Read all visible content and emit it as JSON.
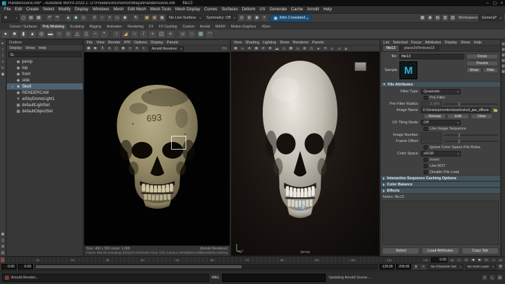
{
  "window": {
    "title": "Randerscene.mb* - Autodesk MAYA 2023.1: D:\\Freelance\\Gnomon\\Maya\\Randerscene.mb",
    "active_node_label": "file13",
    "controls": {
      "minimize": "─",
      "maximize": "▢",
      "close": "×"
    }
  },
  "menu_bar": {
    "items": [
      "File",
      "Edit",
      "Create",
      "Select",
      "Modify",
      "Display",
      "Windows",
      "Mesh",
      "Edit Mesh",
      "Mesh Tools",
      "Mesh Display",
      "Curves",
      "Surfaces",
      "Deform",
      "UV",
      "Generate",
      "Cache",
      "Arnold",
      "Help"
    ]
  },
  "status_line": {
    "menu_set_glyph": "⊞",
    "icons": [
      {
        "name": "new-scene-icon",
        "glyph": "▢"
      },
      {
        "name": "open-scene-icon",
        "glyph": "▤"
      },
      {
        "name": "save-scene-icon",
        "glyph": "▦"
      },
      {
        "name": "separator",
        "glyph": "|",
        "sep": true
      },
      {
        "name": "undo-icon",
        "glyph": "↶"
      },
      {
        "name": "redo-icon",
        "glyph": "↷"
      },
      {
        "name": "separator",
        "glyph": "|",
        "sep": true
      },
      {
        "name": "select-hierarchy-mode-icon",
        "glyph": "▲"
      },
      {
        "name": "select-object-mode-icon",
        "glyph": "◆",
        "color": "#8fd0e8"
      },
      {
        "name": "select-component-mode-icon",
        "glyph": "◇"
      },
      {
        "name": "separator",
        "glyph": "|",
        "sep": true
      },
      {
        "name": "snap-to-grid-icon",
        "glyph": "#"
      },
      {
        "name": "snap-to-curve-icon",
        "glyph": "~"
      },
      {
        "name": "snap-to-point-icon",
        "glyph": "•"
      },
      {
        "name": "snap-to-plane-icon",
        "glyph": "▭"
      },
      {
        "name": "make-live-icon",
        "glyph": "◉"
      },
      {
        "name": "separator",
        "glyph": "|",
        "sep": true
      },
      {
        "name": "construction-history-icon",
        "glyph": "↻"
      },
      {
        "name": "separator",
        "glyph": "|",
        "sep": true
      },
      {
        "name": "render-frame-icon",
        "glyph": "▣",
        "color": "#d9b36c"
      },
      {
        "name": "ipr-render-icon",
        "glyph": "▣",
        "color": "#c98f5a"
      },
      {
        "name": "render-settings-icon",
        "glyph": "▣",
        "color": "#9fb6c9"
      }
    ],
    "live_surface": "No Live Surface",
    "symmetry": "Symmetry: Off",
    "icons2": [
      {
        "name": "soft-selection-icon",
        "glyph": "◎"
      },
      {
        "name": "highlight-backfaces-icon",
        "glyph": "◍"
      },
      {
        "name": "camera-based-selection-icon",
        "glyph": "◉"
      },
      {
        "name": "snap-magnet-icon",
        "glyph": "•"
      }
    ],
    "account": "John Crossland",
    "icons3": [
      {
        "name": "modeling-toolkit-toggle-icon",
        "glyph": "▦"
      },
      {
        "name": "character-controls-toggle-icon",
        "glyph": "◉"
      },
      {
        "name": "channel-box-toggle-icon",
        "glyph": "▤"
      },
      {
        "name": "attribute-editor-toggle-icon",
        "glyph": "▥"
      },
      {
        "name": "tool-settings-toggle-icon",
        "glyph": "▧"
      }
    ],
    "workspace_label": "Workspace:",
    "workspace_value": "General*"
  },
  "shelf": {
    "tabs": [
      {
        "label": "Curves / Surfaces"
      },
      {
        "label": "Poly Modeling",
        "active": true
      },
      {
        "label": "Sculpting"
      },
      {
        "label": "Rigging"
      },
      {
        "label": "Animation"
      },
      {
        "label": "Rendering"
      },
      {
        "label": "FX"
      },
      {
        "label": "FX Caching"
      },
      {
        "label": "Custom"
      },
      {
        "label": "Arnold"
      },
      {
        "label": "MASH"
      },
      {
        "label": "Motion Graphics"
      },
      {
        "label": "XGen"
      }
    ],
    "icons": [
      {
        "name": "poly-sphere-icon",
        "glyph": "●",
        "color": "#b9cfe3"
      },
      {
        "name": "poly-cube-icon",
        "glyph": "■",
        "color": "#b9cfe3"
      },
      {
        "name": "poly-cylinder-icon",
        "glyph": "▮",
        "color": "#b9cfe3"
      },
      {
        "name": "poly-cone-icon",
        "glyph": "▲",
        "color": "#b9cfe3"
      },
      {
        "name": "poly-torus-icon",
        "glyph": "◎",
        "color": "#b9cfe3"
      },
      {
        "name": "poly-plane-icon",
        "glyph": "▬",
        "color": "#b9cfe3"
      },
      {
        "name": "poly-disc-icon",
        "glyph": "○",
        "color": "#b9cfe3"
      },
      {
        "name": "poly-platonic-icon",
        "glyph": "◇",
        "color": "#b9cfe3"
      },
      {
        "name": "poly-pyramid-icon",
        "glyph": "△",
        "color": "#b9cfe3"
      },
      {
        "name": "poly-pipe-icon",
        "glyph": "▯",
        "color": "#b9cfe3"
      },
      {
        "name": "poly-helix-icon",
        "glyph": "~",
        "color": "#b9cfe3"
      },
      {
        "name": "poly-gear-icon",
        "glyph": "*",
        "color": "#b9cfe3"
      },
      {
        "name": "separator",
        "glyph": "|",
        "sep": true
      },
      {
        "name": "extrude-icon",
        "glyph": "↑",
        "color": "#dcb36e"
      },
      {
        "name": "bevel-icon",
        "glyph": "◢",
        "color": "#dcb36e"
      },
      {
        "name": "bridge-icon",
        "glyph": "∩",
        "color": "#dcb36e"
      },
      {
        "name": "multi-cut-icon",
        "glyph": "/",
        "color": "#dcb36e"
      },
      {
        "name": "target-weld-icon",
        "glyph": "+",
        "color": "#dcb36e"
      },
      {
        "name": "mirror-icon",
        "glyph": "◫",
        "color": "#c9c9c9"
      },
      {
        "name": "smooth-icon",
        "glyph": "≈",
        "color": "#c9c9c9"
      },
      {
        "name": "separator",
        "glyph": "|",
        "sep": true
      },
      {
        "name": "boolean-union-icon",
        "glyph": "∪",
        "color": "#a4cb9d"
      },
      {
        "name": "boolean-difference-icon",
        "glyph": "∩",
        "color": "#cb9d9d"
      },
      {
        "name": "quad-draw-icon",
        "glyph": "▦",
        "color": "#9dc4cb"
      },
      {
        "name": "sculpt-brush-icon",
        "glyph": "◠",
        "color": "#cbbf9d"
      }
    ]
  },
  "toolbox": {
    "tools": [
      {
        "name": "select-tool-icon",
        "glyph": "▸"
      },
      {
        "name": "lasso-tool-icon",
        "glyph": "○"
      },
      {
        "name": "paint-select-tool-icon",
        "glyph": "/"
      },
      {
        "name": "move-tool-icon",
        "glyph": "+"
      },
      {
        "name": "rotate-tool-icon",
        "glyph": "↻"
      },
      {
        "name": "scale-tool-icon",
        "glyph": "▣"
      }
    ],
    "layouts": [
      {
        "name": "single-pane-layout-icon",
        "glyph": "▣"
      },
      {
        "name": "two-pane-layout-icon",
        "glyph": "◫"
      },
      {
        "name": "four-pane-layout-icon",
        "glyph": "⊞"
      },
      {
        "name": "outliner-layout-icon",
        "glyph": "▤"
      }
    ]
  },
  "outliner": {
    "title": "Outliner",
    "menus": [
      "Display",
      "Show",
      "Help"
    ],
    "items": [
      {
        "label": "persp",
        "icon": "camera-icon",
        "glyph": "◉",
        "color": "#b9c4cc",
        "arrow": ""
      },
      {
        "label": "top",
        "icon": "camera-icon",
        "glyph": "◉",
        "color": "#b9c4cc",
        "arrow": ""
      },
      {
        "label": "front",
        "icon": "camera-icon",
        "glyph": "◉",
        "color": "#b9c4cc",
        "arrow": ""
      },
      {
        "label": "side",
        "icon": "camera-icon",
        "glyph": "◉",
        "color": "#b9c4cc",
        "arrow": ""
      },
      {
        "label": "Skull",
        "icon": "mesh-icon",
        "glyph": "■",
        "color": "#cdd3d8",
        "arrow": "▸",
        "selected": true
      },
      {
        "label": "RENDERCAM",
        "icon": "camera-icon",
        "glyph": "◉",
        "color": "#b9c4cc",
        "arrow": ""
      },
      {
        "label": "aiSkyDomeLight1",
        "icon": "skydome-light-icon",
        "glyph": "☀",
        "color": "#e6d07b",
        "arrow": ""
      },
      {
        "label": "defaultLightSet",
        "icon": "set-icon",
        "glyph": "▦",
        "color": "#b5b5b5",
        "arrow": ""
      },
      {
        "label": "defaultObjectSet",
        "icon": "set-icon",
        "glyph": "▦",
        "color": "#b5b5b5",
        "arrow": ""
      }
    ]
  },
  "render_view": {
    "menus": [
      "File",
      "View",
      "Render",
      "IPR",
      "Options",
      "Display",
      "Panels"
    ],
    "toolbar_icons": [
      {
        "name": "redraw-render-icon",
        "glyph": "▣"
      },
      {
        "name": "ipr-redraw-icon",
        "glyph": "▶"
      },
      {
        "name": "pause-ipr-icon",
        "glyph": "‖"
      },
      {
        "name": "stop-render-icon",
        "glyph": "■",
        "color": "#d06a5a"
      },
      {
        "name": "region-render-icon",
        "glyph": "▢"
      },
      {
        "name": "snapshot-icon",
        "glyph": "◉"
      },
      {
        "name": "rgb-channels-icon",
        "glyph": "●",
        "color": "#cf6a5a"
      },
      {
        "name": "alpha-channel-icon",
        "glyph": "α"
      },
      {
        "name": "exposure-icon",
        "glyph": "◐"
      }
    ],
    "renderer_label": "Arnold Renderer",
    "progress": "0%",
    "skull_marking": "693",
    "info_size": "Size: 400 x 500  zoom: 1.000",
    "info_renderer": "(Arnold Renderer)",
    "info_stats": "Frame: 950.00   Sampling: [0/0] [0:0:0]   Render Time: 0:01   Camera: RENDERCAM|RENDERCAMShape   [AOV: beauty]"
  },
  "viewport": {
    "menus": [
      "View",
      "Shading",
      "Lighting",
      "Show",
      "Renderer",
      "Panels"
    ],
    "toolbar_icons": [
      {
        "name": "camera-select-icon",
        "glyph": "▣"
      },
      {
        "name": "camera-lock-icon",
        "glyph": "•"
      },
      {
        "name": "bookmark-icon",
        "glyph": "★"
      },
      {
        "name": "image-plane-icon",
        "glyph": "▦"
      },
      {
        "name": "two-d-pan-zoom-icon",
        "glyph": "⇄"
      },
      {
        "name": "grid-toggle-icon",
        "glyph": "⊞"
      },
      {
        "name": "film-gate-icon",
        "glyph": "▬"
      },
      {
        "name": "resolution-gate-icon",
        "glyph": "□"
      },
      {
        "name": "gate-mask-icon",
        "glyph": "▩"
      },
      {
        "name": "hud-toggle-icon",
        "glyph": "≡"
      },
      {
        "name": "xray-icon",
        "glyph": "◍"
      },
      {
        "name": "wireframe-on-shaded-icon",
        "glyph": "◇"
      },
      {
        "name": "textured-mode-icon",
        "glyph": "●"
      },
      {
        "name": "lighting-toggle-icon",
        "glyph": "☀"
      },
      {
        "name": "shadows-toggle-icon",
        "glyph": "◐"
      },
      {
        "name": "ssao-toggle-icon",
        "glyph": "◑"
      },
      {
        "name": "anti-aliasing-toggle-icon",
        "glyph": "▲"
      }
    ],
    "camera_label": "persp"
  },
  "attribute_editor": {
    "menus": [
      "List",
      "Selected",
      "Focus",
      "Attributes",
      "Display",
      "Show",
      "Help"
    ],
    "tabs": [
      {
        "label": "file13",
        "active": true
      },
      {
        "label": "place2dTexture13"
      }
    ],
    "file_label": "file:",
    "file_value": "file13",
    "sample_label": "Sample",
    "sample_logo": "M",
    "focus_button": "Focus",
    "presets_button": "Presets",
    "show_button": "Show",
    "hide_button": "Hide",
    "section_title": "File Attributes",
    "fields": {
      "filter_type_label": "Filter Type",
      "filter_type_value": "Quadratic",
      "pre_filter_label": "Pre Filter",
      "pre_filter_radius_label": "Pre Filter Radius",
      "pre_filter_radius_value": "2.000",
      "image_name_label": "Image Name",
      "image_name_value": "D:\\Desktop\\render\\skanlo\\skull_jaw_diffuse.psd",
      "reload_button": "Reload",
      "edit_button": "Edit",
      "view_button": "View",
      "uv_tiling_label": "UV Tiling Mode",
      "uv_tiling_value": "Off",
      "use_image_sequence_label": "Use Image Sequence",
      "image_number_label": "Image Number",
      "image_number_value": "",
      "frame_offset_label": "Frame Offset",
      "frame_offset_value": "",
      "ignore_color_space_label": "Ignore Color Space File Rules",
      "color_space_label": "Color Space",
      "color_space_value": "sRGB",
      "invert_label": "Invert",
      "use_bot_label": "Use BOT",
      "disable_file_load_label": "Disable File Load"
    },
    "collapsed_sections": [
      "Interactive Sequence Caching Options",
      "Color Balance",
      "Effects"
    ],
    "notes_label": "Notes: file13",
    "select_button": "Select",
    "load_attributes_button": "Load Attributes",
    "copy_tab_button": "Copy Tab"
  },
  "right_strip": {
    "icons": [
      {
        "name": "channel-box-icon",
        "glyph": "▤"
      },
      {
        "name": "attribute-editor-icon",
        "glyph": "▥"
      },
      {
        "name": "tool-settings-icon",
        "glyph": "▦"
      },
      {
        "name": "modeling-toolkit-icon",
        "glyph": "▧"
      },
      {
        "name": "character-controls-icon",
        "glyph": "▨"
      },
      {
        "name": "xgen-panel-icon",
        "glyph": "▩"
      }
    ]
  },
  "time_slider": {
    "ticks": [
      "0",
      "10",
      "20",
      "30",
      "40",
      "50",
      "60",
      "70",
      "80",
      "90",
      "100",
      "110",
      "120"
    ],
    "current_frame": "0.00",
    "playback": [
      {
        "name": "go-to-start-button",
        "glyph": "«"
      },
      {
        "name": "step-back-frame-button",
        "glyph": "‹"
      },
      {
        "name": "step-back-key-button",
        "glyph": "◁"
      },
      {
        "name": "play-backwards-button",
        "glyph": "◀"
      },
      {
        "name": "play-forwards-button",
        "glyph": "▶"
      },
      {
        "name": "step-forward-key-button",
        "glyph": "▷"
      },
      {
        "name": "step-forward-frame-button",
        "glyph": "›"
      },
      {
        "name": "go-to-end-button",
        "glyph": "»"
      }
    ]
  },
  "range_slider": {
    "anim_start": "0.00",
    "play_start": "0.00",
    "play_end": "120.00",
    "anim_end": "200.00",
    "key_glyph": "♦",
    "autokey_glyph": "●",
    "prefs_glyph": "⚙",
    "character_set": "No Character Set",
    "anim_layer": "No Anim Layer"
  },
  "bottom_bar": {
    "progress_text": "Arnold Render...",
    "command_label": "MEL",
    "command_value": "",
    "help_text": "Updating Arnold Scene ...",
    "icons": [
      {
        "name": "script-editor-icon",
        "glyph": "≡"
      },
      {
        "name": "command-shell-icon",
        "glyph": "›_"
      },
      {
        "name": "output-window-icon",
        "glyph": "▤"
      }
    ]
  },
  "colors": {
    "accent_blue": "#1e4c72",
    "section_header_teal": "#44525a",
    "maya_teal": "#2fb3c9",
    "selection_highlight": "#4e6170",
    "manipulator_blue": "#56b1ff"
  }
}
